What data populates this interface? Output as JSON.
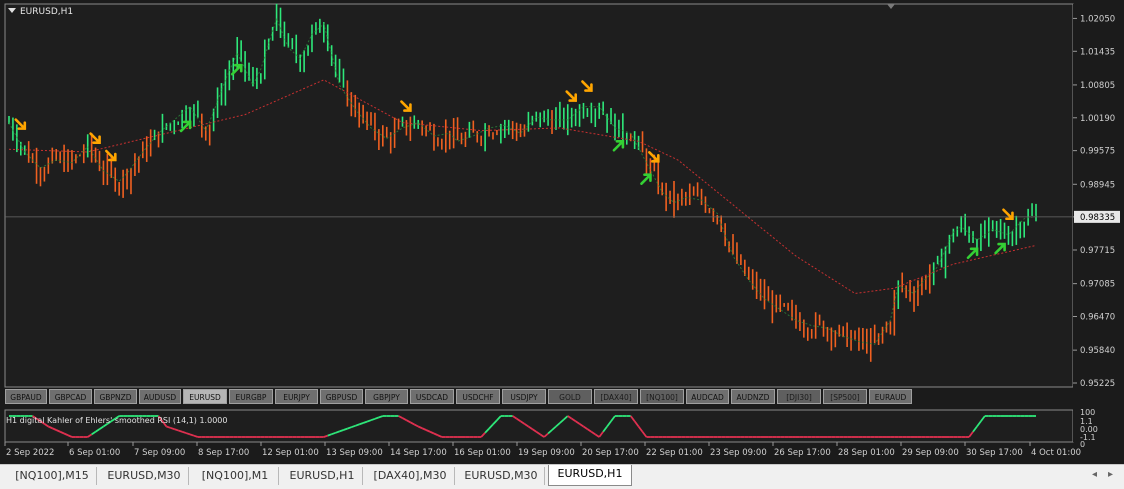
{
  "window": {
    "title": "EURUSD,H1"
  },
  "chart_data": {
    "type": "line",
    "symbol": "EURUSD",
    "timeframe": "H1",
    "y_ticks": [
      "1.02050",
      "1.01435",
      "1.00805",
      "1.00190",
      "0.99575",
      "0.98945",
      "0.98335",
      "0.97715",
      "0.97085",
      "0.96470",
      "0.95840",
      "0.95225"
    ],
    "ylim": [
      0.9515,
      1.0232
    ],
    "current_price": "0.98335",
    "x_ticks": [
      "2 Sep 2022",
      "6 Sep 01:00",
      "7 Sep 09:00",
      "8 Sep 17:00",
      "12 Sep 01:00",
      "13 Sep 09:00",
      "14 Sep 17:00",
      "16 Sep 01:00",
      "19 Sep 09:00",
      "20 Sep 17:00",
      "22 Sep 01:00",
      "23 Sep 09:00",
      "26 Sep 17:00",
      "28 Sep 01:00",
      "29 Sep 09:00",
      "30 Sep 17:00",
      "4 Oct 01:00"
    ],
    "price_path": {
      "x_index": [
        0,
        4,
        8,
        12,
        16,
        20,
        24,
        28,
        30,
        34,
        38,
        42,
        46,
        50,
        52,
        55,
        58,
        62,
        64,
        68,
        71,
        74,
        77,
        80,
        84,
        88,
        92,
        96,
        100,
        104,
        108,
        112,
        114,
        118,
        122,
        126,
        130,
        134,
        138,
        142,
        146,
        150,
        154,
        158,
        162,
        166,
        169,
        172,
        176,
        180,
        184,
        188,
        192,
        196,
        200,
        204,
        208,
        212,
        216,
        220,
        224,
        226,
        230,
        232,
        236,
        240,
        242,
        246,
        250,
        254,
        258,
        261
      ],
      "close": [
        1.001,
        0.9955,
        0.9925,
        0.994,
        0.9935,
        0.9965,
        0.992,
        0.99,
        0.9915,
        0.9955,
        0.999,
        1.0015,
        1.004,
        0.9995,
        1.003,
        1.009,
        1.014,
        1.008,
        1.011,
        1.0205,
        1.015,
        1.013,
        1.0175,
        1.0195,
        1.008,
        1.0035,
        1.0,
        0.998,
        1.0,
        1.001,
        0.9985,
        0.999,
        0.9975,
        0.9985,
        1.0,
        1.0005,
        0.999,
        1.002,
        1.0015,
        1.0015,
        1.004,
        1.004,
        1.0,
        0.999,
        0.9935,
        0.988,
        0.986,
        0.987,
        0.9865,
        0.984,
        0.976,
        0.9715,
        0.968,
        0.966,
        0.964,
        0.963,
        0.9625,
        0.961,
        0.96,
        0.9595,
        0.964,
        0.9705,
        0.969,
        0.971,
        0.974,
        0.9805,
        0.9815,
        0.979,
        0.981,
        0.98,
        0.983,
        0.9835
      ]
    },
    "ma_slow": {
      "x_index": [
        0,
        20,
        40,
        60,
        80,
        100,
        120,
        140,
        160,
        170,
        180,
        200,
        215,
        225,
        240,
        261
      ],
      "value": [
        0.996,
        0.9955,
        0.999,
        1.0025,
        1.009,
        1.001,
        0.9995,
        1.0,
        0.9975,
        0.994,
        0.988,
        0.976,
        0.969,
        0.97,
        0.9745,
        0.978
      ]
    },
    "signals": [
      {
        "x": 3,
        "dir": "down"
      },
      {
        "x": 22,
        "dir": "down"
      },
      {
        "x": 26,
        "dir": "down"
      },
      {
        "x": 45,
        "dir": "up"
      },
      {
        "x": 58,
        "dir": "up"
      },
      {
        "x": 101,
        "dir": "down"
      },
      {
        "x": 143,
        "dir": "down"
      },
      {
        "x": 147,
        "dir": "down"
      },
      {
        "x": 155,
        "dir": "up"
      },
      {
        "x": 162,
        "dir": "up"
      },
      {
        "x": 164,
        "dir": "down"
      },
      {
        "x": 245,
        "dir": "up"
      },
      {
        "x": 252,
        "dir": "up"
      },
      {
        "x": 254,
        "dir": "down"
      }
    ],
    "indicator": {
      "label": "H1 digital Kahler of Ehlers' smoothed RSI  (14,1) 1.0000",
      "y_ticks": [
        "100",
        "1.1",
        "0.00",
        "-1.1",
        "0"
      ],
      "x_index": [
        0,
        6,
        10,
        16,
        20,
        24,
        28,
        38,
        40,
        48,
        50,
        58,
        70,
        80,
        95,
        99,
        104,
        110,
        120,
        125,
        128,
        132,
        136,
        142,
        146,
        150,
        154,
        158,
        162,
        170,
        180,
        200,
        230,
        244,
        248,
        252,
        258,
        261
      ],
      "value": [
        1,
        1,
        0,
        -1,
        -1,
        0,
        1,
        1,
        0,
        -1,
        -1,
        -1,
        -1,
        -1,
        1,
        1,
        0,
        -1,
        -1,
        1,
        1,
        0,
        -1,
        1,
        0,
        -1,
        1,
        1,
        -1,
        -1,
        -1,
        -1,
        -1,
        -1,
        1,
        1,
        1,
        1
      ]
    },
    "colors": {
      "up": "#2ee87a",
      "down": "#f06020",
      "ma": "#c83030",
      "ind_up": "#2ee87a",
      "ind_down": "#e03050",
      "arrow_up": "#34d034",
      "arrow_down": "#ffa500"
    }
  },
  "symbols": [
    "GBPAUD",
    "GBPCAD",
    "GBPNZD",
    "AUDUSD",
    "EURUSD",
    "EURGBP",
    "EURJPY",
    "GBPUSD",
    "GBPJPY",
    "USDCAD",
    "USDCHF",
    "USDJPY",
    "GOLD",
    "[DAX40]",
    "[NQ100]",
    "AUDCAD",
    "AUDNZD",
    "[DJI30]",
    "[SP500]",
    "EURAUD"
  ],
  "active_symbol": "EURUSD",
  "tabs": [
    "[NQ100],M15",
    "EURUSD,M30",
    "[NQ100],M1",
    "EURUSD,H1",
    "[DAX40],M30",
    "EURUSD,M30",
    "EURUSD,H1"
  ],
  "active_tab_index": 6
}
